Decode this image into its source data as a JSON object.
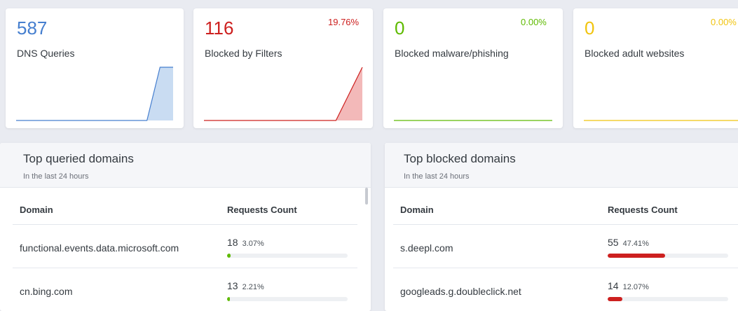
{
  "stats": [
    {
      "value": "587",
      "label": "DNS Queries",
      "percent": "",
      "color": "#467fcf",
      "fill": "#c9dcf2",
      "spark": [
        0,
        0,
        0,
        0,
        0,
        0,
        0,
        0,
        0,
        0,
        0,
        1,
        1
      ]
    },
    {
      "value": "116",
      "label": "Blocked by Filters",
      "percent": "19.76%",
      "color": "#cd201f",
      "fill": "#f3b9b9",
      "spark": [
        0,
        0,
        0,
        0,
        0,
        0,
        0,
        0,
        0,
        0,
        0,
        0.5,
        1
      ]
    },
    {
      "value": "0",
      "label": "Blocked malware/phishing",
      "percent": "0.00%",
      "color": "#5eba00",
      "fill": "#dff0c9",
      "spark": [
        0,
        0,
        0,
        0,
        0,
        0,
        0,
        0,
        0,
        0,
        0,
        0,
        0
      ]
    },
    {
      "value": "0",
      "label": "Blocked adult websites",
      "percent": "0.00%",
      "color": "#f1c40f",
      "fill": "#fbf0c4",
      "spark": [
        0,
        0,
        0,
        0,
        0,
        0,
        0,
        0,
        0,
        0,
        0,
        0,
        0
      ]
    }
  ],
  "top_queried": {
    "title": "Top queried domains",
    "subtitle": "In the last 24 hours",
    "col_domain": "Domain",
    "col_count": "Requests Count",
    "bar_color": "#5eba00",
    "rows": [
      {
        "domain": "functional.events.data.microsoft.com",
        "count": "18",
        "percent": "3.07%",
        "fraction": 0.0307
      },
      {
        "domain": "cn.bing.com",
        "count": "13",
        "percent": "2.21%",
        "fraction": 0.0221
      }
    ]
  },
  "top_blocked": {
    "title": "Top blocked domains",
    "subtitle": "In the last 24 hours",
    "col_domain": "Domain",
    "col_count": "Requests Count",
    "bar_color": "#cd201f",
    "rows": [
      {
        "domain": "s.deepl.com",
        "count": "55",
        "percent": "47.41%",
        "fraction": 0.4741
      },
      {
        "domain": "googleads.g.doubleclick.net",
        "count": "14",
        "percent": "12.07%",
        "fraction": 0.1207
      }
    ]
  }
}
